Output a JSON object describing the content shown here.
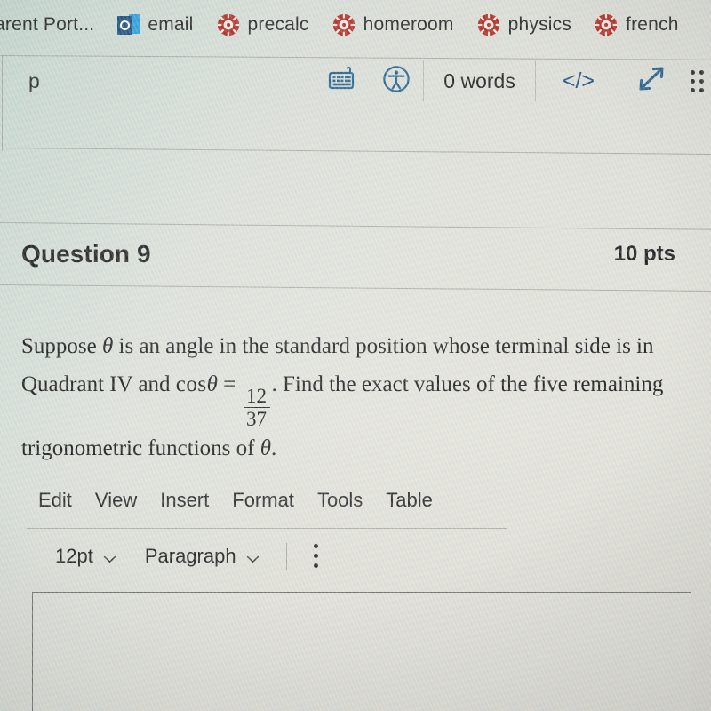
{
  "browser": {
    "bookmarks": [
      {
        "label": "arent Port...",
        "icon": "none"
      },
      {
        "label": "email",
        "icon": "outlook-icon"
      },
      {
        "label": "precalc",
        "icon": "canvas-icon"
      },
      {
        "label": "homeroom",
        "icon": "canvas-icon"
      },
      {
        "label": "physics",
        "icon": "canvas-icon"
      },
      {
        "label": "french",
        "icon": "canvas-icon"
      }
    ]
  },
  "editor_status": {
    "element_path": "p",
    "keyboard_shortcuts_title": "keyboard-shortcuts-icon",
    "accessibility_title": "accessibility-checker-icon",
    "word_count": "0 words",
    "html_editor_label": "</>",
    "resize_title": "fullscreen-resize-icon",
    "drag_handle_title": "drag-handle-icon"
  },
  "question": {
    "title": "Question 9",
    "points": "10 pts",
    "body": {
      "line1_part1": "Suppose ",
      "theta1": "θ",
      "line1_part2": " is an angle in the standard position whose terminal side is in Quadrant IV and ",
      "cos_op": "cos",
      "theta2": "θ",
      "equals": " = ",
      "fraction_numerator": "12",
      "fraction_denominator": "37",
      "line2_part": ". Find the exact values of the five remaining trigonometric functions of ",
      "theta3": "θ",
      "period": "."
    }
  },
  "rce": {
    "menubar": [
      "Edit",
      "View",
      "Insert",
      "Format",
      "Tools",
      "Table"
    ],
    "toolbar": {
      "font_size": "12pt",
      "block_format": "Paragraph",
      "more_label": "more-options"
    },
    "answer_area_value": ""
  },
  "colors": {
    "accent_blue": "#1d4f82",
    "canvas_red": "#b32a24",
    "outlook_blue": "#2e9fd8",
    "text_dark": "#1d1d1d",
    "rule_gray": "#a9aaa4"
  }
}
